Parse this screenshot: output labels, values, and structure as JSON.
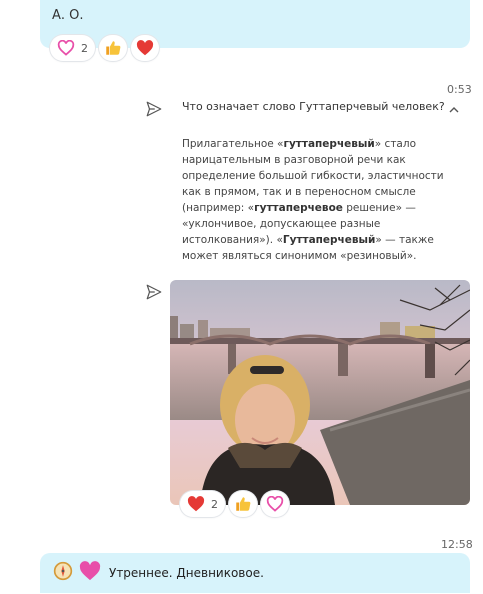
{
  "top_message": {
    "author": "А. О.",
    "reactions": [
      {
        "icon": "outline-heart-icon",
        "count": "2"
      },
      {
        "icon": "thumbs-up-icon",
        "count": ""
      },
      {
        "icon": "red-heart-icon",
        "count": ""
      }
    ]
  },
  "query_message": {
    "time": "0:53",
    "question": "Что означает слово Гуттаперчевый человек?",
    "answer_parts": [
      {
        "text": "Прилагательное «",
        "bold": false
      },
      {
        "text": "гуттаперчевый",
        "bold": true
      },
      {
        "text": "» стало нарицательным в разговорной речи как определение большой гибкости, эластичности как в прямом, так и в переносном смысле (например: «",
        "bold": false
      },
      {
        "text": "гуттаперчевое",
        "bold": true
      },
      {
        "text": " решение» — «уклончивое, допускающее разные истолкования»). «",
        "bold": false
      },
      {
        "text": "Гуттаперчевый",
        "bold": true
      },
      {
        "text": "» — также может являться синонимом «резиновый».",
        "bold": false
      }
    ]
  },
  "photo_message": {
    "reactions": [
      {
        "icon": "red-heart-icon",
        "count": "2"
      },
      {
        "icon": "thumbs-up-icon",
        "count": ""
      },
      {
        "icon": "outline-heart-icon",
        "count": ""
      }
    ]
  },
  "bottom_message": {
    "time": "12:58",
    "text": "Утреннее. Дневниковое."
  },
  "colors": {
    "bubble": "#d7f3fb",
    "heart": "#e53935",
    "accent_pink": "#e84fa9"
  }
}
